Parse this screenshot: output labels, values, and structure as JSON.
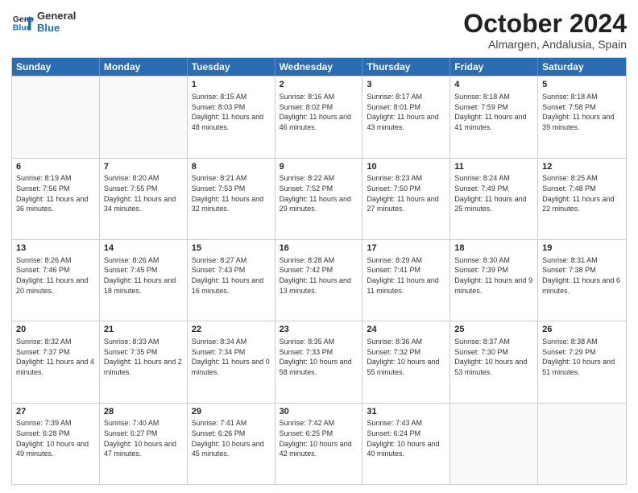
{
  "header": {
    "logo_line1": "General",
    "logo_line2": "Blue",
    "month": "October 2024",
    "location": "Almargen, Andalusia, Spain"
  },
  "days_of_week": [
    "Sunday",
    "Monday",
    "Tuesday",
    "Wednesday",
    "Thursday",
    "Friday",
    "Saturday"
  ],
  "weeks": [
    [
      {
        "day": "",
        "sunrise": "",
        "sunset": "",
        "daylight": ""
      },
      {
        "day": "",
        "sunrise": "",
        "sunset": "",
        "daylight": ""
      },
      {
        "day": "1",
        "sunrise": "Sunrise: 8:15 AM",
        "sunset": "Sunset: 8:03 PM",
        "daylight": "Daylight: 11 hours and 48 minutes."
      },
      {
        "day": "2",
        "sunrise": "Sunrise: 8:16 AM",
        "sunset": "Sunset: 8:02 PM",
        "daylight": "Daylight: 11 hours and 46 minutes."
      },
      {
        "day": "3",
        "sunrise": "Sunrise: 8:17 AM",
        "sunset": "Sunset: 8:01 PM",
        "daylight": "Daylight: 11 hours and 43 minutes."
      },
      {
        "day": "4",
        "sunrise": "Sunrise: 8:18 AM",
        "sunset": "Sunset: 7:59 PM",
        "daylight": "Daylight: 11 hours and 41 minutes."
      },
      {
        "day": "5",
        "sunrise": "Sunrise: 8:18 AM",
        "sunset": "Sunset: 7:58 PM",
        "daylight": "Daylight: 11 hours and 39 minutes."
      }
    ],
    [
      {
        "day": "6",
        "sunrise": "Sunrise: 8:19 AM",
        "sunset": "Sunset: 7:56 PM",
        "daylight": "Daylight: 11 hours and 36 minutes."
      },
      {
        "day": "7",
        "sunrise": "Sunrise: 8:20 AM",
        "sunset": "Sunset: 7:55 PM",
        "daylight": "Daylight: 11 hours and 34 minutes."
      },
      {
        "day": "8",
        "sunrise": "Sunrise: 8:21 AM",
        "sunset": "Sunset: 7:53 PM",
        "daylight": "Daylight: 11 hours and 32 minutes."
      },
      {
        "day": "9",
        "sunrise": "Sunrise: 8:22 AM",
        "sunset": "Sunset: 7:52 PM",
        "daylight": "Daylight: 11 hours and 29 minutes."
      },
      {
        "day": "10",
        "sunrise": "Sunrise: 8:23 AM",
        "sunset": "Sunset: 7:50 PM",
        "daylight": "Daylight: 11 hours and 27 minutes."
      },
      {
        "day": "11",
        "sunrise": "Sunrise: 8:24 AM",
        "sunset": "Sunset: 7:49 PM",
        "daylight": "Daylight: 11 hours and 25 minutes."
      },
      {
        "day": "12",
        "sunrise": "Sunrise: 8:25 AM",
        "sunset": "Sunset: 7:48 PM",
        "daylight": "Daylight: 11 hours and 22 minutes."
      }
    ],
    [
      {
        "day": "13",
        "sunrise": "Sunrise: 8:26 AM",
        "sunset": "Sunset: 7:46 PM",
        "daylight": "Daylight: 11 hours and 20 minutes."
      },
      {
        "day": "14",
        "sunrise": "Sunrise: 8:26 AM",
        "sunset": "Sunset: 7:45 PM",
        "daylight": "Daylight: 11 hours and 18 minutes."
      },
      {
        "day": "15",
        "sunrise": "Sunrise: 8:27 AM",
        "sunset": "Sunset: 7:43 PM",
        "daylight": "Daylight: 11 hours and 16 minutes."
      },
      {
        "day": "16",
        "sunrise": "Sunrise: 8:28 AM",
        "sunset": "Sunset: 7:42 PM",
        "daylight": "Daylight: 11 hours and 13 minutes."
      },
      {
        "day": "17",
        "sunrise": "Sunrise: 8:29 AM",
        "sunset": "Sunset: 7:41 PM",
        "daylight": "Daylight: 11 hours and 11 minutes."
      },
      {
        "day": "18",
        "sunrise": "Sunrise: 8:30 AM",
        "sunset": "Sunset: 7:39 PM",
        "daylight": "Daylight: 11 hours and 9 minutes."
      },
      {
        "day": "19",
        "sunrise": "Sunrise: 8:31 AM",
        "sunset": "Sunset: 7:38 PM",
        "daylight": "Daylight: 11 hours and 6 minutes."
      }
    ],
    [
      {
        "day": "20",
        "sunrise": "Sunrise: 8:32 AM",
        "sunset": "Sunset: 7:37 PM",
        "daylight": "Daylight: 11 hours and 4 minutes."
      },
      {
        "day": "21",
        "sunrise": "Sunrise: 8:33 AM",
        "sunset": "Sunset: 7:35 PM",
        "daylight": "Daylight: 11 hours and 2 minutes."
      },
      {
        "day": "22",
        "sunrise": "Sunrise: 8:34 AM",
        "sunset": "Sunset: 7:34 PM",
        "daylight": "Daylight: 11 hours and 0 minutes."
      },
      {
        "day": "23",
        "sunrise": "Sunrise: 8:35 AM",
        "sunset": "Sunset: 7:33 PM",
        "daylight": "Daylight: 10 hours and 58 minutes."
      },
      {
        "day": "24",
        "sunrise": "Sunrise: 8:36 AM",
        "sunset": "Sunset: 7:32 PM",
        "daylight": "Daylight: 10 hours and 55 minutes."
      },
      {
        "day": "25",
        "sunrise": "Sunrise: 8:37 AM",
        "sunset": "Sunset: 7:30 PM",
        "daylight": "Daylight: 10 hours and 53 minutes."
      },
      {
        "day": "26",
        "sunrise": "Sunrise: 8:38 AM",
        "sunset": "Sunset: 7:29 PM",
        "daylight": "Daylight: 10 hours and 51 minutes."
      }
    ],
    [
      {
        "day": "27",
        "sunrise": "Sunrise: 7:39 AM",
        "sunset": "Sunset: 6:28 PM",
        "daylight": "Daylight: 10 hours and 49 minutes."
      },
      {
        "day": "28",
        "sunrise": "Sunrise: 7:40 AM",
        "sunset": "Sunset: 6:27 PM",
        "daylight": "Daylight: 10 hours and 47 minutes."
      },
      {
        "day": "29",
        "sunrise": "Sunrise: 7:41 AM",
        "sunset": "Sunset: 6:26 PM",
        "daylight": "Daylight: 10 hours and 45 minutes."
      },
      {
        "day": "30",
        "sunrise": "Sunrise: 7:42 AM",
        "sunset": "Sunset: 6:25 PM",
        "daylight": "Daylight: 10 hours and 42 minutes."
      },
      {
        "day": "31",
        "sunrise": "Sunrise: 7:43 AM",
        "sunset": "Sunset: 6:24 PM",
        "daylight": "Daylight: 10 hours and 40 minutes."
      },
      {
        "day": "",
        "sunrise": "",
        "sunset": "",
        "daylight": ""
      },
      {
        "day": "",
        "sunrise": "",
        "sunset": "",
        "daylight": ""
      }
    ]
  ]
}
